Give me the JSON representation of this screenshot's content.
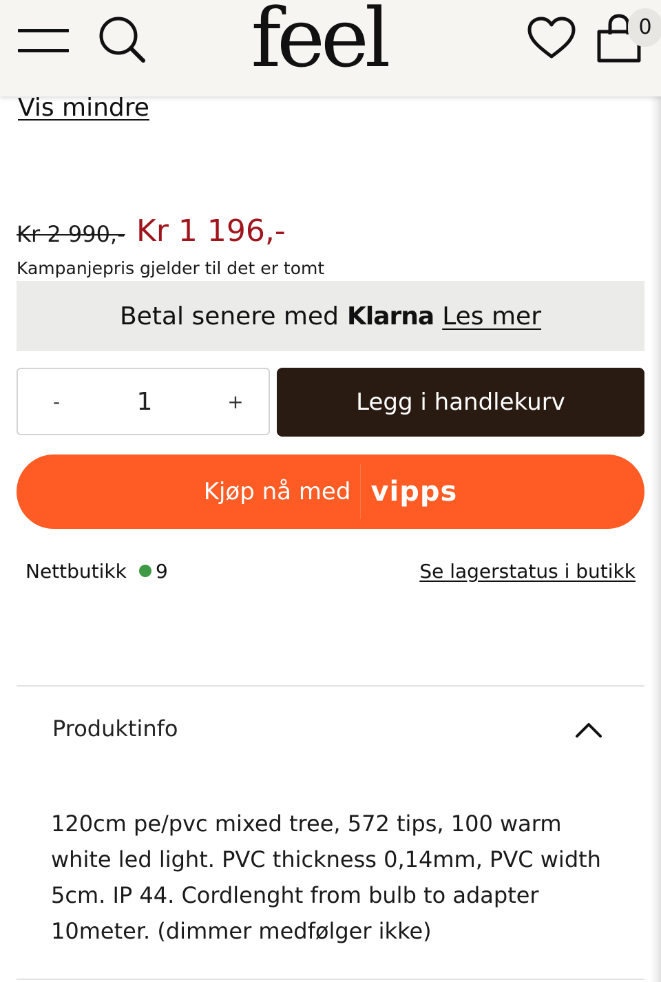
{
  "header": {
    "logo": "feel",
    "cart_count": "0"
  },
  "details": {
    "toggle_label": "Vis mindre"
  },
  "price": {
    "original": "Kr 2 990,-",
    "sale": "Kr 1 196,-",
    "campaign_note": "Kampanjepris gjelder til det er tomt",
    "sale_color": "#a0151d"
  },
  "klarna": {
    "text": "Betal senere med",
    "brand": "Klarna",
    "link": "Les mer"
  },
  "quantity": {
    "minus": "-",
    "value": "1",
    "plus": "+"
  },
  "add_to_cart": {
    "label": "Legg i handlekurv",
    "color": "#2a1b12"
  },
  "vipps": {
    "label": "Kjøp nå med",
    "brand": "vipps",
    "color": "#ff5b24"
  },
  "stock": {
    "label": "Nettbutikk",
    "count": "9",
    "status_color": "#3e9a44",
    "store_link": "Se lagerstatus i butikk"
  },
  "product_info": {
    "title": "Produktinfo",
    "expanded": true,
    "description": "120cm pe/pvc mixed tree, 572 tips, 100 warm white led light. PVC thickness 0,14mm, PVC width 5cm. IP 44. Cordlenght from bulb to adapter 10meter. (dimmer medfølger ikke)"
  },
  "icons": [
    "menu-icon",
    "search-icon",
    "heart-icon",
    "shopping-bag-icon",
    "chevron-up-icon"
  ]
}
